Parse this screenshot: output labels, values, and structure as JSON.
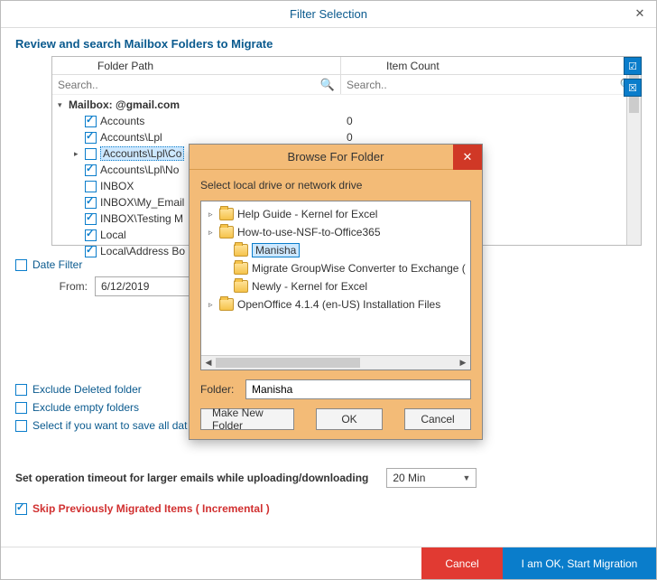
{
  "titlebar": {
    "title": "Filter Selection"
  },
  "section": {
    "review": "Review and search Mailbox Folders to Migrate"
  },
  "columns": {
    "folder_path": "Folder Path",
    "item_count": "Item Count"
  },
  "search": {
    "placeholder_fp": "Search..",
    "placeholder_ic": "Search.."
  },
  "tree": [
    {
      "label": "Mailbox:                  @gmail.com",
      "root": true,
      "indent": 0,
      "caret": "▾",
      "checked": false
    },
    {
      "label": "Accounts",
      "indent": 1,
      "checked": true,
      "count": "0"
    },
    {
      "label": "Accounts\\Lpl",
      "indent": 1,
      "checked": true,
      "count": "0"
    },
    {
      "label": "Accounts\\Lpl\\Co",
      "indent": 1,
      "checked": false,
      "selected": true,
      "caret": "▸"
    },
    {
      "label": "Accounts\\Lpl\\No",
      "indent": 1,
      "checked": true
    },
    {
      "label": "INBOX",
      "indent": 1,
      "checked": false
    },
    {
      "label": "INBOX\\My_Email",
      "indent": 1,
      "checked": true
    },
    {
      "label": "INBOX\\Testing M",
      "indent": 1,
      "checked": true
    },
    {
      "label": "Local",
      "indent": 1,
      "checked": true
    },
    {
      "label": "Local\\Address Bo",
      "indent": 1,
      "checked": true
    }
  ],
  "date_filter": {
    "label": "Date Filter",
    "from_label": "From:",
    "from_value": "6/12/2019"
  },
  "exclude_deleted": "Exclude Deleted folder",
  "exclude_empty": "Exclude empty folders",
  "save_all": "Select if you want to save all dat",
  "timeout": {
    "label": "Set operation timeout for larger emails while uploading/downloading",
    "value": "20 Min"
  },
  "skip_incremental": "Skip Previously Migrated Items ( Incremental )",
  "buttons": {
    "cancel": "Cancel",
    "start": "I am OK, Start Migration"
  },
  "modal": {
    "title": "Browse For Folder",
    "instruction": "Select local drive or network drive",
    "items": [
      {
        "label": "Help Guide - Kernel for Excel",
        "caret": "▹",
        "indent": 0
      },
      {
        "label": "How-to-use-NSF-to-Office365",
        "caret": "▹",
        "indent": 0
      },
      {
        "label": "Manisha",
        "caret": "",
        "indent": 1,
        "selected": true
      },
      {
        "label": "Migrate GroupWise Converter to Exchange (",
        "caret": "",
        "indent": 1
      },
      {
        "label": "Newly - Kernel for Excel",
        "caret": "",
        "indent": 1
      },
      {
        "label": "OpenOffice 4.1.4 (en-US) Installation Files",
        "caret": "▹",
        "indent": 0
      }
    ],
    "folder_label": "Folder:",
    "folder_value": "Manisha",
    "make_new": "Make New Folder",
    "ok": "OK",
    "cancel": "Cancel"
  }
}
